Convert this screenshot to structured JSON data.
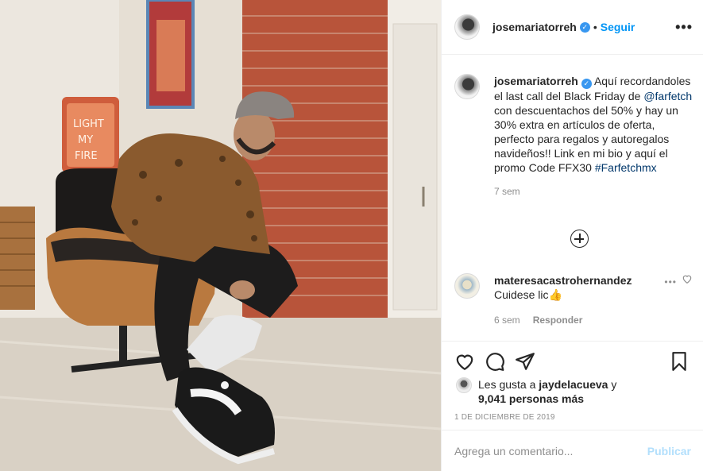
{
  "post": {
    "photo_alt": "",
    "header": {
      "username": "josemariatorreh",
      "verified_mark": "✓",
      "separator": "•",
      "follow_label": "Seguir",
      "more_label": "•••"
    },
    "caption": {
      "username": "josemariatorreh",
      "text_before_mention": "Aquí recordandoles el last call del Black Friday de ",
      "mention": "@farfetch",
      "text_after_mention": " con descuentachos del 50% y hay un 30% extra en artículos de oferta, perfecto para regalos y autoregalos navideños!! Link en mi bio y aquí el promo Code FFX30 ",
      "hashtag": "#Farfetchmx",
      "time": "7 sem"
    },
    "comment": {
      "username": "materesacastrohernandez",
      "text": "Cuidese lic👍",
      "time": "6 sem",
      "reply_label": "Responder",
      "more_label": "•••"
    },
    "likes": {
      "prefix": "Les gusta a ",
      "user": "jaydelacueva",
      "connector": " y",
      "count_text": "9,041 personas más"
    },
    "date": "1 DE DICIEMBRE DE 2019",
    "composer": {
      "placeholder": "Agrega un comentario...",
      "publish_label": "Publicar"
    },
    "icons": {
      "like": "heart-icon",
      "comment": "comment-icon",
      "share": "paper-plane-icon",
      "save": "bookmark-icon",
      "load_more": "plus-circle-icon"
    },
    "colors": {
      "accent": "#0095f6",
      "link": "#00376b",
      "muted": "#8e8e8e",
      "verified": "#3897f0"
    }
  }
}
